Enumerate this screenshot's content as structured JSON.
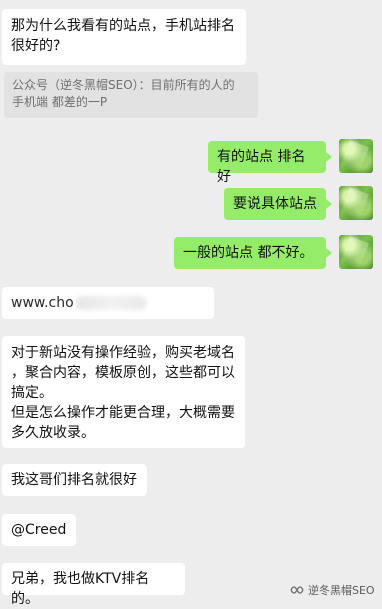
{
  "messages": {
    "m1_line1": "那为什么我看有的站点，手机站排名",
    "m1_line2": "很好的?",
    "quote_line1": "公众号（逆冬黑帽SEO）：目前所有的人的",
    "quote_line2": "手机端 都差的一P",
    "out1": "有的站点 排名好",
    "out2": "要说具体站点",
    "out3": "一般的站点 都不好。",
    "url_prefix": "www.cho",
    "m5_line1": "对于新站没有操作经验，购买老域名",
    "m5_line2": "，聚合内容，模板原创，这些都可以",
    "m5_line3": "搞定。",
    "m5_line4": "但是怎么操作才能更合理，大概需要",
    "m5_line5": "多久放收录。",
    "m6": "我这哥们排名就很好",
    "m7": "@Creed",
    "m8": "兄弟，我也做KTV排名的。"
  },
  "watermark": {
    "text": "逆冬黑帽SEO",
    "icon": "wechat-channel-icon"
  },
  "colors": {
    "background": "#ededed",
    "incoming": "#ffffff",
    "outgoing": "#95ec69",
    "quote": "#e2e2e2"
  }
}
